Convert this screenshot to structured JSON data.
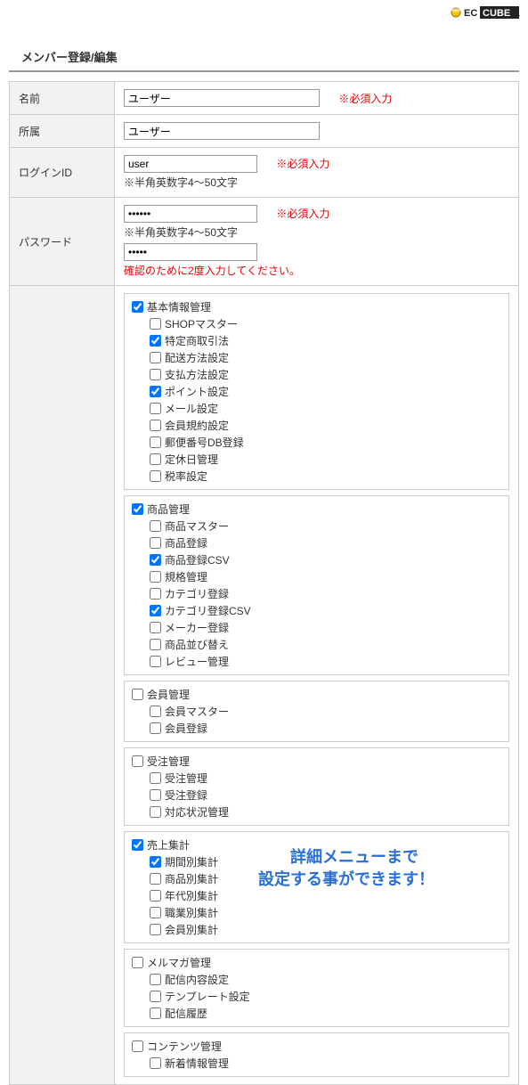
{
  "brand": {
    "name": "EC CUBE"
  },
  "page_title": "メンバー登録/編集",
  "required_mark": "※必須入力",
  "fields": {
    "name": {
      "label": "名前",
      "value": "ユーザー"
    },
    "dept": {
      "label": "所属",
      "value": "ユーザー"
    },
    "login_id": {
      "label": "ログインID",
      "value": "user",
      "hint": "※半角英数字4～50文字"
    },
    "password": {
      "label": "パスワード",
      "value1": "******",
      "hint": "※半角英数字4～50文字",
      "value2": "*****",
      "confirm_note": "確認のために2度入力してください。"
    }
  },
  "perm_groups": [
    {
      "label": "基本情報管理",
      "checked": true,
      "children": [
        {
          "label": "SHOPマスター",
          "checked": false
        },
        {
          "label": "特定商取引法",
          "checked": true
        },
        {
          "label": "配送方法設定",
          "checked": false
        },
        {
          "label": "支払方法設定",
          "checked": false
        },
        {
          "label": "ポイント設定",
          "checked": true
        },
        {
          "label": "メール設定",
          "checked": false
        },
        {
          "label": "会員規約設定",
          "checked": false
        },
        {
          "label": "郵便番号DB登録",
          "checked": false
        },
        {
          "label": "定休日管理",
          "checked": false
        },
        {
          "label": "税率設定",
          "checked": false
        }
      ]
    },
    {
      "label": "商品管理",
      "checked": true,
      "children": [
        {
          "label": "商品マスター",
          "checked": false
        },
        {
          "label": "商品登録",
          "checked": false
        },
        {
          "label": "商品登録CSV",
          "checked": true
        },
        {
          "label": "規格管理",
          "checked": false
        },
        {
          "label": "カテゴリ登録",
          "checked": false
        },
        {
          "label": "カテゴリ登録CSV",
          "checked": true
        },
        {
          "label": "メーカー登録",
          "checked": false
        },
        {
          "label": "商品並び替え",
          "checked": false
        },
        {
          "label": "レビュー管理",
          "checked": false
        }
      ]
    },
    {
      "label": "会員管理",
      "checked": false,
      "children": [
        {
          "label": "会員マスター",
          "checked": false
        },
        {
          "label": "会員登録",
          "checked": false
        }
      ]
    },
    {
      "label": "受注管理",
      "checked": false,
      "children": [
        {
          "label": "受注管理",
          "checked": false
        },
        {
          "label": "受注登録",
          "checked": false
        },
        {
          "label": "対応状況管理",
          "checked": false
        }
      ]
    },
    {
      "label": "売上集計",
      "checked": true,
      "children": [
        {
          "label": "期間別集計",
          "checked": true
        },
        {
          "label": "商品別集計",
          "checked": false
        },
        {
          "label": "年代別集計",
          "checked": false
        },
        {
          "label": "職業別集計",
          "checked": false
        },
        {
          "label": "会員別集計",
          "checked": false
        }
      ]
    },
    {
      "label": "メルマガ管理",
      "checked": false,
      "children": [
        {
          "label": "配信内容設定",
          "checked": false
        },
        {
          "label": "テンプレート設定",
          "checked": false
        },
        {
          "label": "配信履歴",
          "checked": false
        }
      ]
    },
    {
      "label": "コンテンツ管理",
      "checked": false,
      "children": [
        {
          "label": "新着情報管理",
          "checked": false
        }
      ]
    }
  ],
  "overlay_note": "　　詳細メニューまで\n設定する事ができます！"
}
